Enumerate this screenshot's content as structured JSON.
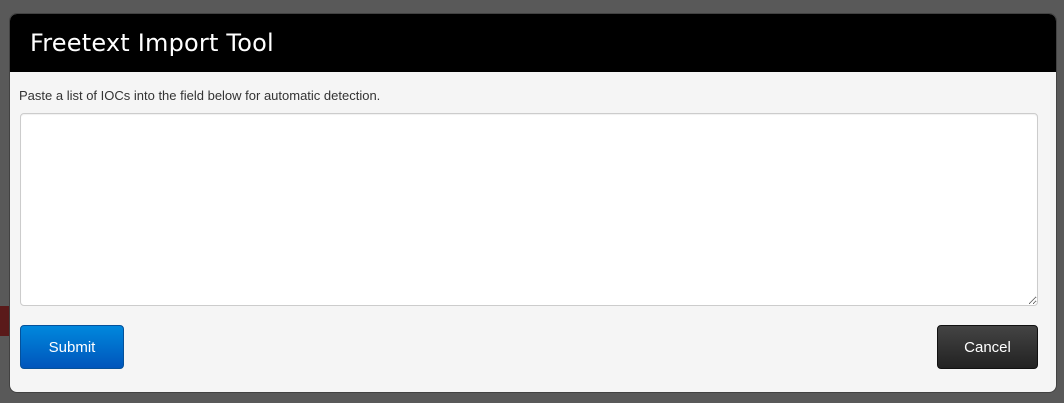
{
  "modal": {
    "title": "Freetext Import Tool",
    "instructions": "Paste a list of IOCs into the field below for automatic detection.",
    "textarea_value": "",
    "submit_label": "Submit",
    "cancel_label": "Cancel"
  },
  "colors": {
    "header_bg": "#000000",
    "modal_bg": "#f5f5f5",
    "submit_bg": "#0066cc",
    "cancel_bg": "#333333",
    "backdrop": "#595959"
  }
}
